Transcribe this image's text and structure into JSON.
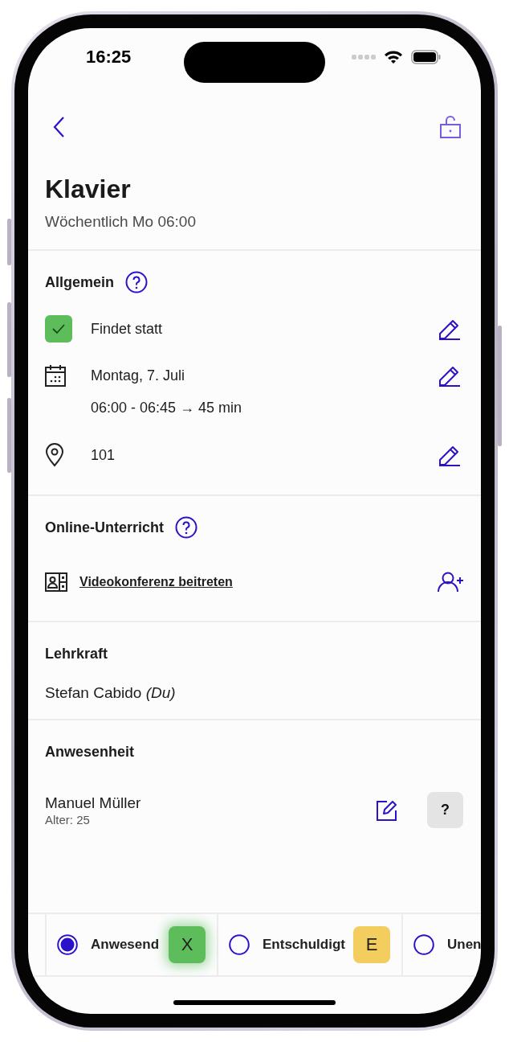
{
  "status_bar": {
    "time": "16:25"
  },
  "header": {
    "title": "Klavier",
    "subtitle": "Wöchentlich Mo 06:00"
  },
  "general": {
    "heading": "Allgemein",
    "items": [
      {
        "kind": "status",
        "lines": [
          "Findet statt"
        ],
        "checked": true
      },
      {
        "kind": "date",
        "lines": [
          "Montag, 7. Juli",
          "06:00 - 06:45 → 45 min"
        ]
      },
      {
        "kind": "location",
        "lines": [
          "101"
        ]
      }
    ]
  },
  "online": {
    "heading": "Online-Unterricht",
    "link": "Videokonferenz beitreten"
  },
  "teacher": {
    "heading": "Lehrkraft",
    "name": "Stefan Cabido *(Du)*"
  },
  "attendance": {
    "heading": "Anwesenheit",
    "students": [
      {
        "name": "Manuel Müller",
        "age": "Alter: 25",
        "status": "?"
      }
    ]
  },
  "attendance_bar": [
    {
      "label": "Anwesend",
      "key": "X",
      "color": "#5cbd5a",
      "selected": true
    },
    {
      "label": "Entschuldigt",
      "key": "E",
      "color": "#f3cd5e",
      "selected": false
    },
    {
      "label": "Unen",
      "selected": false
    }
  ]
}
